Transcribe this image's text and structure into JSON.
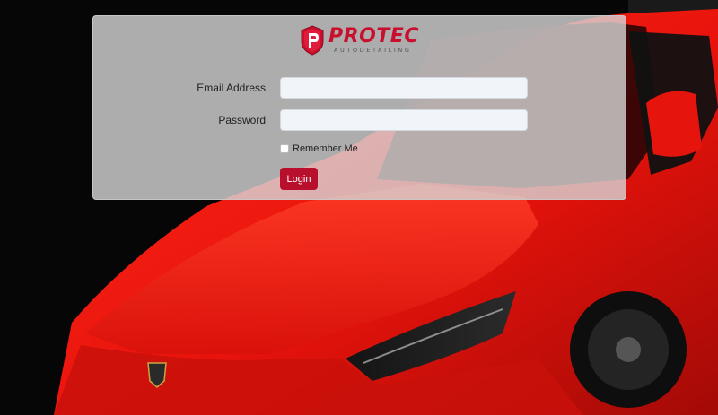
{
  "brand": {
    "name": "PROTEC",
    "tagline": "AUTODETAILING",
    "logo_icon": "shield-p-icon",
    "accent_color": "#c8102e"
  },
  "form": {
    "email_label": "Email Address",
    "email_value": "",
    "password_label": "Password",
    "password_value": "",
    "remember_label": "Remember Me",
    "remember_checked": false,
    "login_label": "Login"
  },
  "background": {
    "car_color": "#e8130c"
  }
}
